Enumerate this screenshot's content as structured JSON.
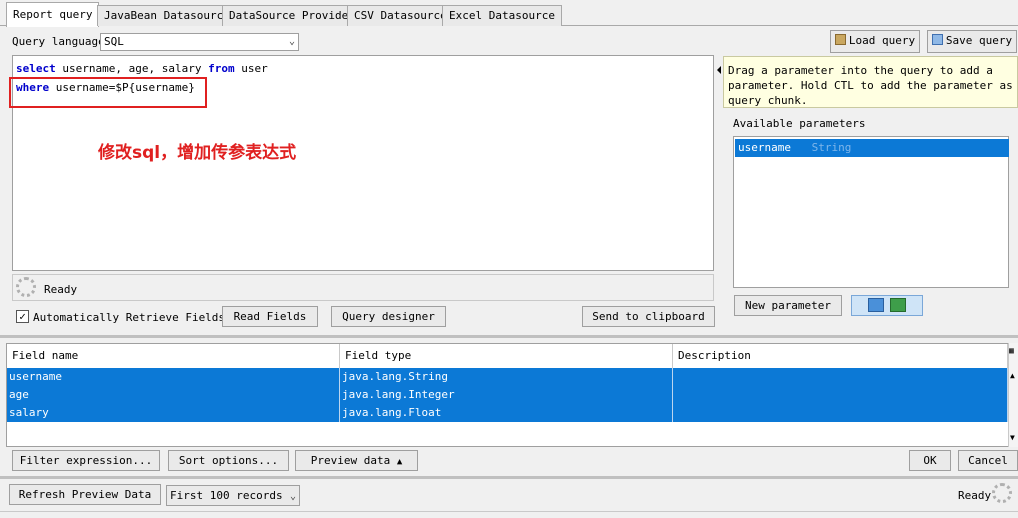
{
  "tabs": [
    {
      "label": "Report query"
    },
    {
      "label": "JavaBean Datasource"
    },
    {
      "label": "DataSource Provider"
    },
    {
      "label": "CSV Datasource"
    },
    {
      "label": "Excel Datasource"
    }
  ],
  "query_language": {
    "label": "Query language",
    "value": "SQL"
  },
  "toolbar": {
    "load_label": "Load query",
    "save_label": "Save query"
  },
  "editor": {
    "line1": {
      "kw1": "select",
      "t1": " username, age, salary ",
      "kw2": "from",
      "t2": " user"
    },
    "line2": {
      "kw1": "where",
      "t1": " username=$P{username}"
    }
  },
  "annotation": "修改sql，增加传参表达式",
  "editor_status": "Ready",
  "auto_retrieve_label": "Automatically Retrieve Fields",
  "actions": {
    "read_fields": "Read Fields",
    "query_designer": "Query designer",
    "send_clipboard": "Send to clipboard"
  },
  "help_text": "Drag a parameter into the query to add a parameter. Hold CTL to add the parameter as query chunk.",
  "parameters": {
    "title": "Available parameters",
    "items": [
      {
        "name": "username",
        "type": "String"
      }
    ],
    "new_label": "New parameter"
  },
  "fields": {
    "headers": [
      "Field name",
      "Field type",
      "Description"
    ],
    "rows": [
      {
        "name": "username",
        "type": "java.lang.String",
        "desc": ""
      },
      {
        "name": "age",
        "type": "java.lang.Integer",
        "desc": ""
      },
      {
        "name": "salary",
        "type": "java.lang.Float",
        "desc": ""
      }
    ]
  },
  "bottom": {
    "filter": "Filter expression...",
    "sort": "Sort options...",
    "preview": "Preview data",
    "ok": "OK",
    "cancel": "Cancel",
    "refresh": "Refresh Preview Data",
    "records": "First 100 records",
    "status": "Ready"
  },
  "colors": {
    "selection": "#0c79d6",
    "keyword": "#0000cc",
    "annotation": "#e02020"
  }
}
